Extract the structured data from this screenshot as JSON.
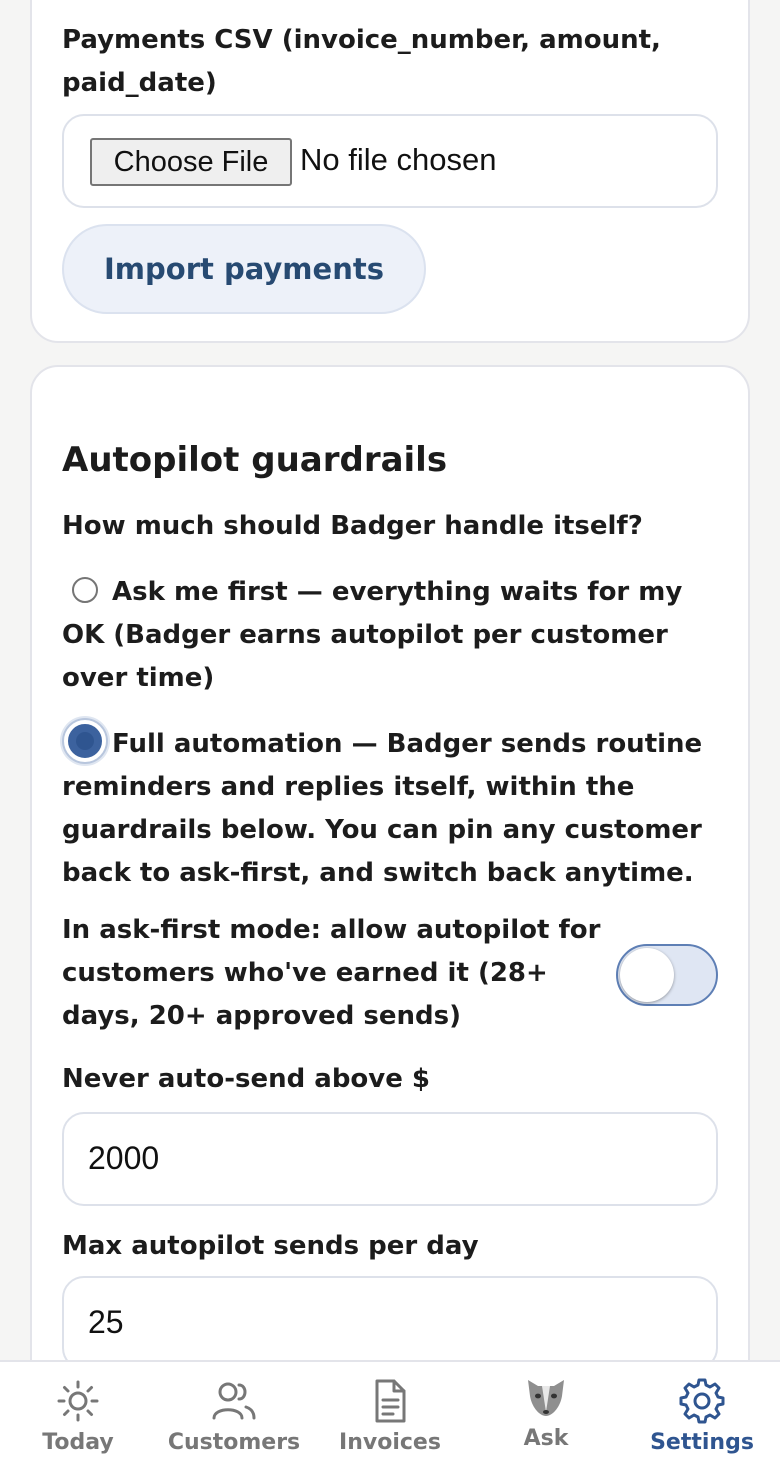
{
  "payments": {
    "csv_label": "Payments CSV (invoice_number, amount, paid_date)",
    "choose_file_label": "Choose File",
    "file_status": "No file chosen",
    "import_button": "Import payments"
  },
  "guardrails": {
    "title": "Autopilot guardrails",
    "question": "How much should Badger handle itself?",
    "mode_options": [
      {
        "label": "Ask me first — everything waits for my OK (Badger earns autopilot per customer over time)",
        "selected": false
      },
      {
        "label": "Full automation — Badger sends routine reminders and replies itself, within the guardrails below. You can pin any customer back to ask-first, and switch back anytime.",
        "selected": true
      }
    ],
    "earned_toggle_label": "In ask-first mode: allow autopilot for customers who've earned it (28+ days, 20+ approved sends)",
    "earned_toggle_on": false,
    "max_amount_label": "Never auto-send above $",
    "max_amount_value": "2000",
    "max_sends_label": "Max autopilot sends per day",
    "max_sends_value": "25"
  },
  "nav": {
    "items": [
      {
        "label": "Today",
        "icon": "sun-icon",
        "active": false
      },
      {
        "label": "Customers",
        "icon": "users-icon",
        "active": false
      },
      {
        "label": "Invoices",
        "icon": "document-icon",
        "active": false
      },
      {
        "label": "Ask",
        "icon": "badger-icon",
        "active": false
      },
      {
        "label": "Settings",
        "icon": "gear-icon",
        "active": true
      }
    ],
    "active_color": "#2f5590",
    "inactive_color": "#777777"
  }
}
